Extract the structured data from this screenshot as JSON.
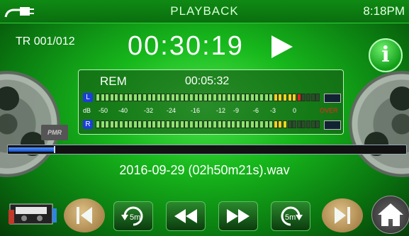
{
  "header": {
    "title": "PLAYBACK",
    "clock": "8:18PM"
  },
  "track": {
    "label": "TR 001/012"
  },
  "timer": {
    "elapsed": "00:30:19"
  },
  "meter": {
    "rem_label": "REM",
    "rem_time": "00:05:32",
    "channel_left": "L",
    "channel_right": "R",
    "scale": [
      "dB",
      "-50",
      "-40",
      "-32",
      "-24",
      "-16",
      "-12",
      "-9",
      "-6",
      "-3",
      "0"
    ],
    "over_label": "OVER",
    "left_level_segments": 44,
    "right_level_segments": 41
  },
  "progress": {
    "fraction": 0.21
  },
  "file": {
    "name": "2016-09-29 (02h50m21s).wav"
  },
  "brand": {
    "badge": "PMR"
  },
  "icons": {
    "power": "plug-icon",
    "play": "play-icon",
    "info": "info-icon",
    "tape": "cassette-icon",
    "prev": "skip-previous-icon",
    "back5": "rewind-5s-icon",
    "rewind": "rewind-icon",
    "forward": "fast-forward-icon",
    "fwd5": "forward-5s-icon",
    "next": "skip-next-icon",
    "home": "home-icon"
  },
  "info_glyph": "i",
  "skip_seconds_label": "5m",
  "colors": {
    "accent": "#17b81c",
    "progress": "#2f6be0",
    "over": "#ff2020"
  }
}
